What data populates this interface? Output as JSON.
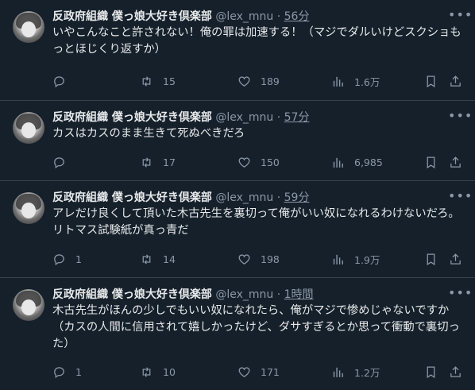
{
  "tweets": [
    {
      "name": "反政府組織 僕っ娘大好き倶楽部",
      "handle": "@lex_mnu",
      "sep": "·",
      "time": "56分",
      "text": "いやこんなこと許されない！俺の罪は加速する！（マジでダルいけどスクショもっとほじくり返すか）",
      "replies": "",
      "retweets": "15",
      "likes": "189",
      "views": "1.6万"
    },
    {
      "name": "反政府組織 僕っ娘大好き倶楽部",
      "handle": "@lex_mnu",
      "sep": "·",
      "time": "57分",
      "text": "カスはカスのまま生きて死ぬべきだろ",
      "replies": "",
      "retweets": "17",
      "likes": "150",
      "views": "6,985"
    },
    {
      "name": "反政府組織 僕っ娘大好き倶楽部",
      "handle": "@lex_mnu",
      "sep": "·",
      "time": "59分",
      "text": "アレだけ良くして頂いた木古先生を裏切って俺がいい奴になれるわけないだろ。リトマス試験紙が真っ青だ",
      "replies": "1",
      "retweets": "14",
      "likes": "198",
      "views": "1.9万"
    },
    {
      "name": "反政府組織 僕っ娘大好き倶楽部",
      "handle": "@lex_mnu",
      "sep": "·",
      "time": "1時間",
      "text": "木古先生がほんの少しでもいい奴になれたら、俺がマジで惨めじゃないですか（カスの人間に信用されて嬉しかったけど、ダサすぎるとか思って衝動で裏切った）",
      "replies": "1",
      "retweets": "10",
      "likes": "171",
      "views": "1.2万"
    }
  ]
}
